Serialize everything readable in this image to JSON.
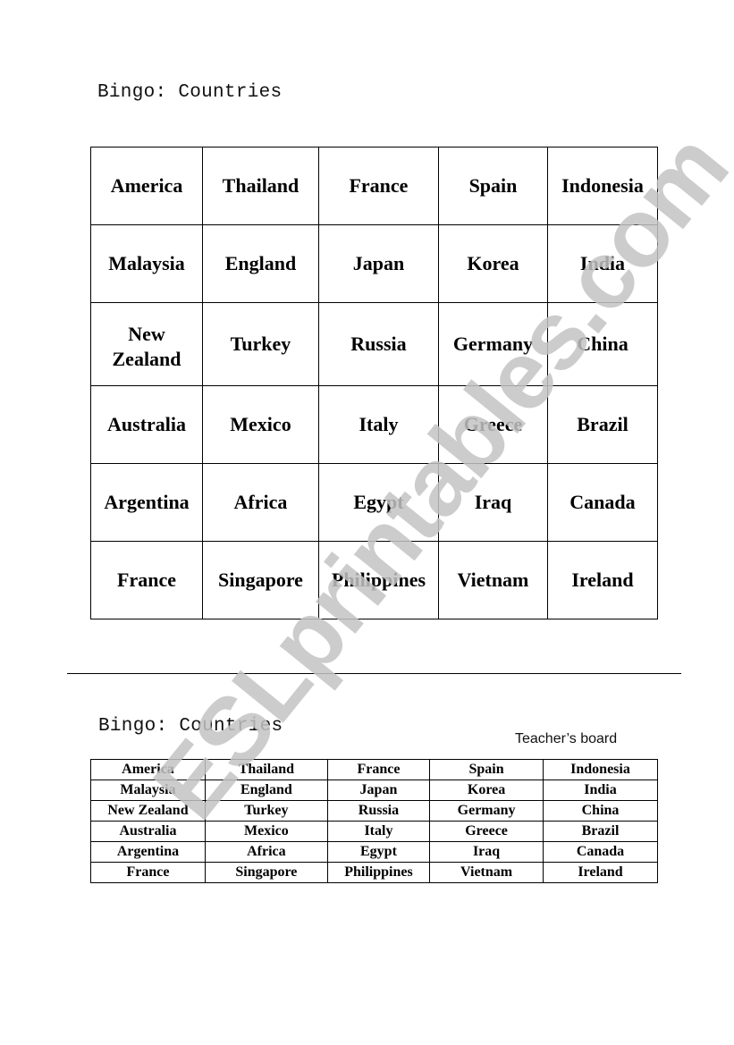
{
  "worksheet": {
    "title": "Bingo: Countries",
    "student_board": {
      "rows": [
        [
          "America",
          "Thailand",
          "France",
          "Spain",
          "Indonesia"
        ],
        [
          "Malaysia",
          "England",
          "Japan",
          "Korea",
          "India"
        ],
        [
          "New Zealand",
          "Turkey",
          "Russia",
          "Germany",
          "China"
        ],
        [
          "Australia",
          "Mexico",
          "Italy",
          "Greece",
          "Brazil"
        ],
        [
          "Argentina",
          "Africa",
          "Egypt",
          "Iraq",
          "Canada"
        ],
        [
          "France",
          "Singapore",
          "Philippines",
          "Vietnam",
          "Ireland"
        ]
      ]
    },
    "teacher_section": {
      "title": "Bingo: Countries",
      "label": "Teacher’s board",
      "rows": [
        [
          "America",
          "Thailand",
          "France",
          "Spain",
          "Indonesia"
        ],
        [
          "Malaysia",
          "England",
          "Japan",
          "Korea",
          "India"
        ],
        [
          "New Zealand",
          "Turkey",
          "Russia",
          "Germany",
          "China"
        ],
        [
          "Australia",
          "Mexico",
          "Italy",
          "Greece",
          "Brazil"
        ],
        [
          "Argentina",
          "Africa",
          "Egypt",
          "Iraq",
          "Canada"
        ],
        [
          "France",
          "Singapore",
          "Philippines",
          "Vietnam",
          "Ireland"
        ]
      ]
    }
  },
  "watermark": {
    "text": "ESLprintables.com",
    "color": "#c4c4c4"
  }
}
